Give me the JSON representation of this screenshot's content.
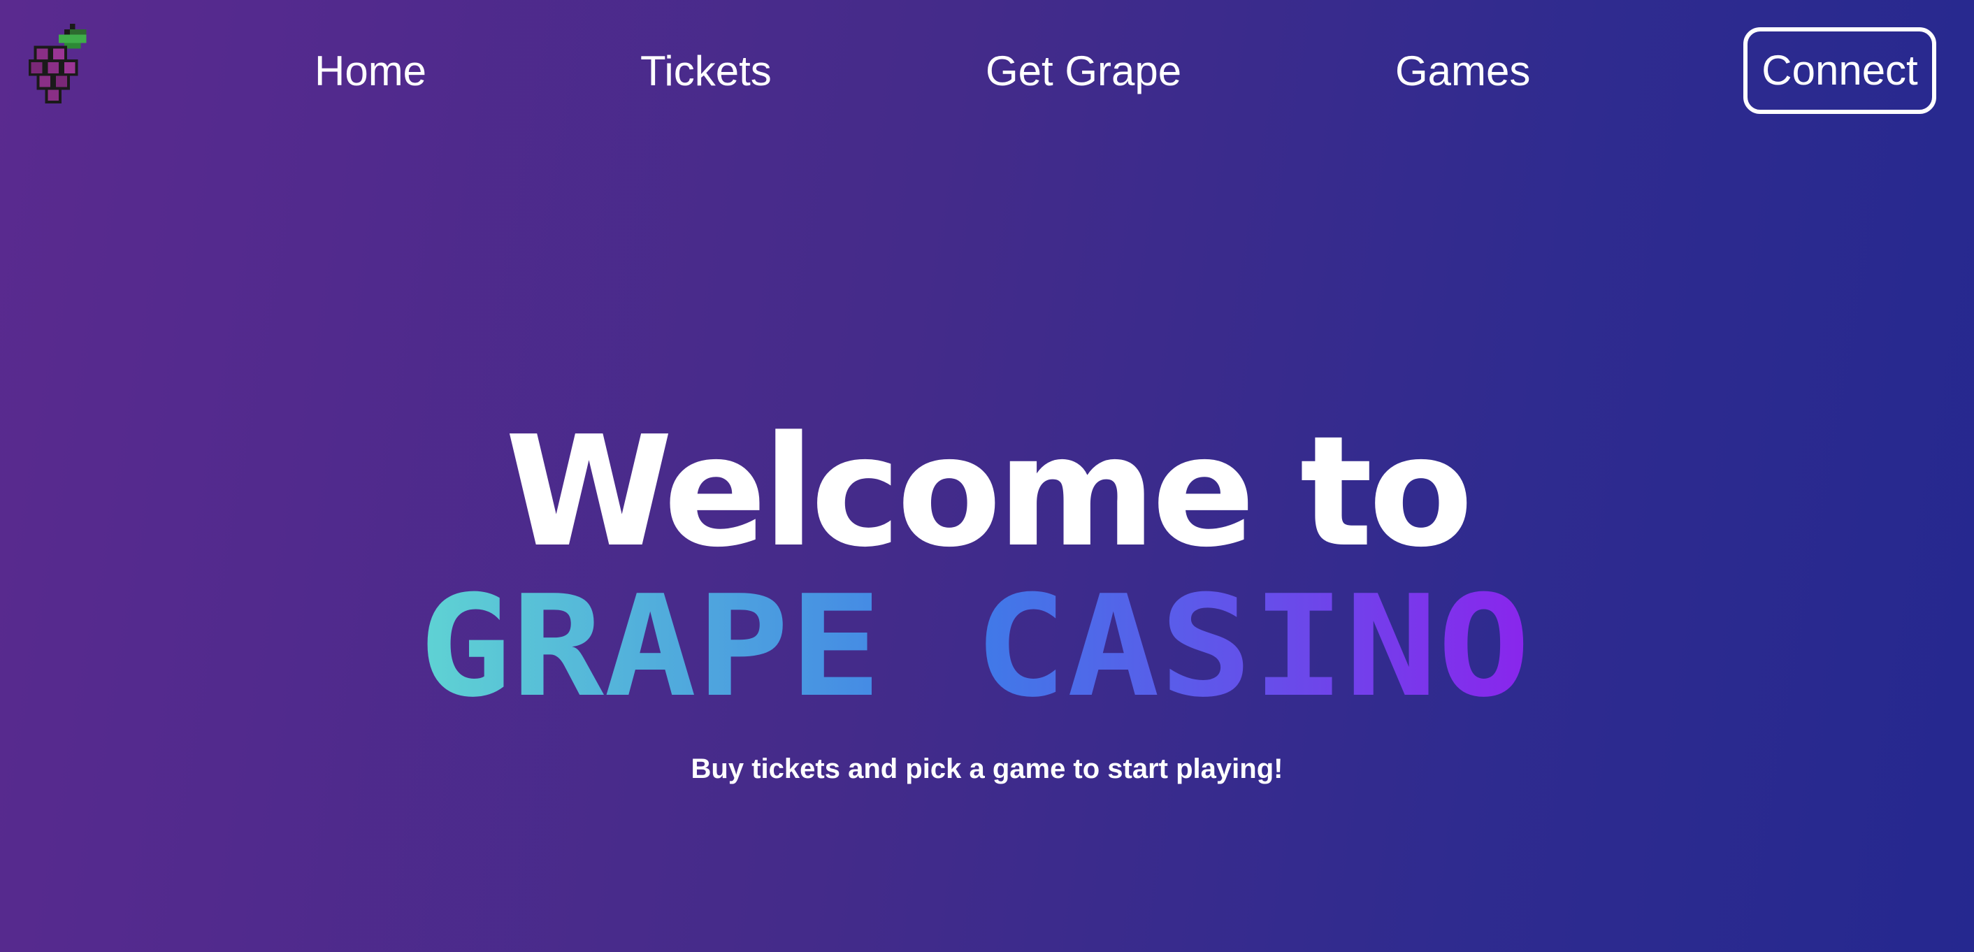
{
  "nav": {
    "logo_icon": "grape-icon",
    "links": [
      {
        "label": "Home"
      },
      {
        "label": "Tickets"
      },
      {
        "label": "Get Grape"
      },
      {
        "label": "Games"
      }
    ],
    "connect_label": "Connect"
  },
  "hero": {
    "welcome": "Welcome to",
    "title": "GRAPE CASINO",
    "title_gradient": [
      "#5fd3d3",
      "#3f7be8",
      "#8a25ec"
    ],
    "subtitle": "Buy tickets and pick a game to start playing!"
  },
  "colors": {
    "background_start": "#5a2a8f",
    "background_end": "#25288f",
    "text": "#ffffff",
    "grape_purple": "#8a2f86",
    "leaf_green": "#3fae4a"
  }
}
